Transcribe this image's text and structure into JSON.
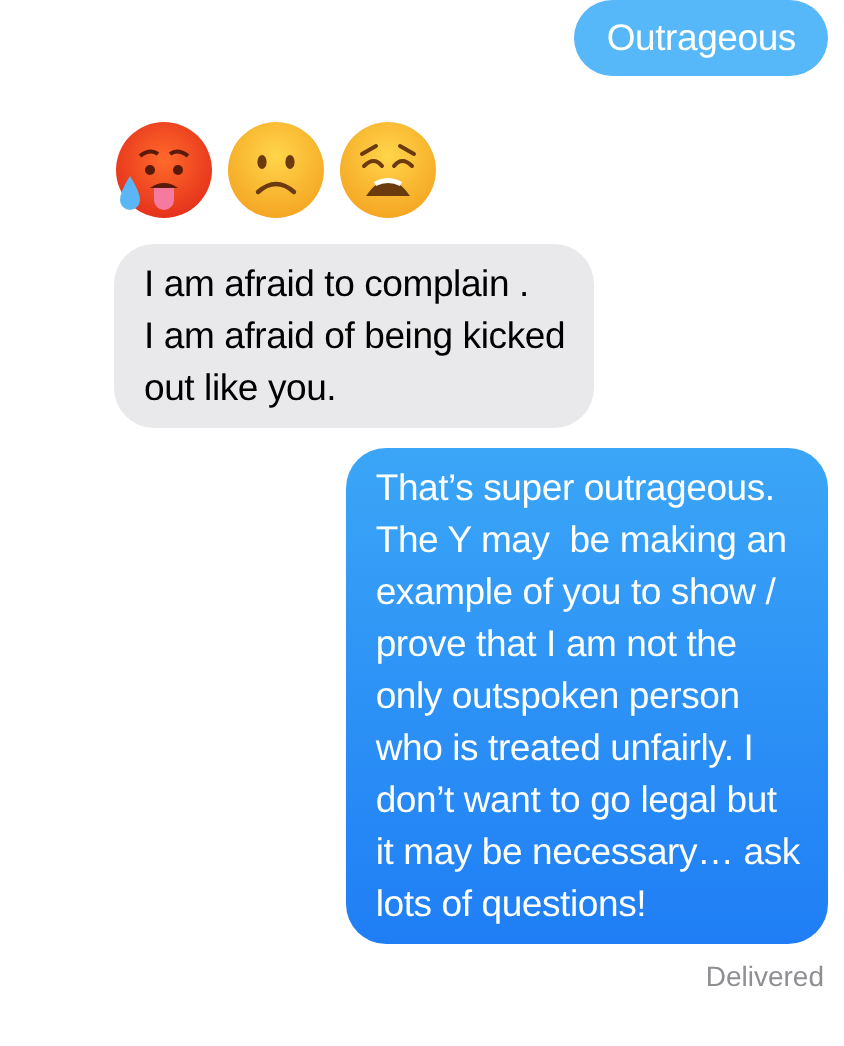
{
  "messages": [
    {
      "kind": "text",
      "outgoing": true,
      "text": "Outrageous"
    },
    {
      "kind": "emoji",
      "outgoing": false,
      "faces": [
        {
          "kind": "hot"
        },
        {
          "kind": "frown"
        },
        {
          "kind": "weary"
        }
      ]
    },
    {
      "kind": "text",
      "outgoing": false,
      "text": "I am afraid to complain .\nI am afraid of being kicked\nout like you."
    },
    {
      "kind": "text",
      "outgoing": true,
      "text": "That’s super outrageous.\nThe Y may  be making an\nexample of you to show /\nprove that I am not the\nonly outspoken person\nwho is treated unfairly. I\ndon’t want to go legal but\nit may be necessary… ask\nlots of questions!"
    }
  ],
  "status": "Delivered"
}
